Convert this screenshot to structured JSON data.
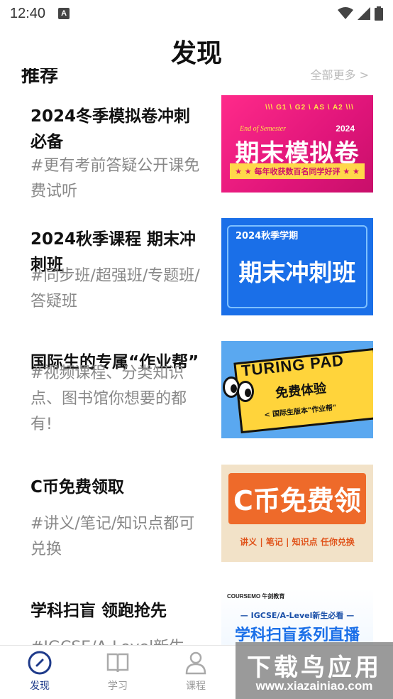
{
  "status_bar": {
    "time": "12:40",
    "notification_glyph": "A",
    "icons": [
      "wifi-icon",
      "signal-icon",
      "battery-icon"
    ]
  },
  "header": {
    "title": "发现"
  },
  "section": {
    "title": "推荐",
    "more_label": "全部更多 >"
  },
  "cards": [
    {
      "title": "2024冬季模拟卷冲刺必备",
      "desc": "#更有考前答疑公开课免费试听",
      "thumb": {
        "tags": "\\\\\\  G1 \\ G2 \\ AS \\ A2  \\\\\\",
        "eyebrow": "End of Semester",
        "year": "2024",
        "headline": "期末模拟卷",
        "band": "★ ★  每年收获数百名同学好评  ★ ★"
      }
    },
    {
      "title": "2024秋季课程 期末冲刺班",
      "desc": "#同步班/超强班/专题班/答疑班",
      "thumb": {
        "head": "2024秋季学期",
        "headline": "期末冲刺班"
      }
    },
    {
      "title": "国际生的专属“作业帮”",
      "desc": "#视频课程、分类知识点、图书馆你想要的都有!",
      "thumb": {
        "brand": "TURING PAD",
        "headline": "免费体验",
        "sub": "< 国际生版本\"作业帮\""
      }
    },
    {
      "title": "C币免费领取",
      "desc": "#讲义/笔记/知识点都可兑换",
      "thumb": {
        "headline": "C币免费领",
        "sub": "讲义 | 笔记 | 知识点 任你兑换"
      }
    },
    {
      "title": "学科扫盲 领跑抢先",
      "desc": "#IGCSE/A-Level新生",
      "thumb": {
        "brand": "COURSEMO 牛剑教育",
        "sub": "— IGCSE/A-Level新生必看 —",
        "headline": "学科扫盲系列直播"
      }
    }
  ],
  "bottom_nav": [
    {
      "label": "发现",
      "icon": "compass-icon",
      "active": true
    },
    {
      "label": "学习",
      "icon": "book-icon",
      "active": false
    },
    {
      "label": "课程",
      "icon": "person-icon",
      "active": false
    }
  ],
  "watermark": {
    "title": "下载鸟应用",
    "url": "www.xiazainiao.com"
  },
  "colors": {
    "accent": "#1e3a8a",
    "muted": "#888888",
    "nav_inactive": "#999999"
  }
}
